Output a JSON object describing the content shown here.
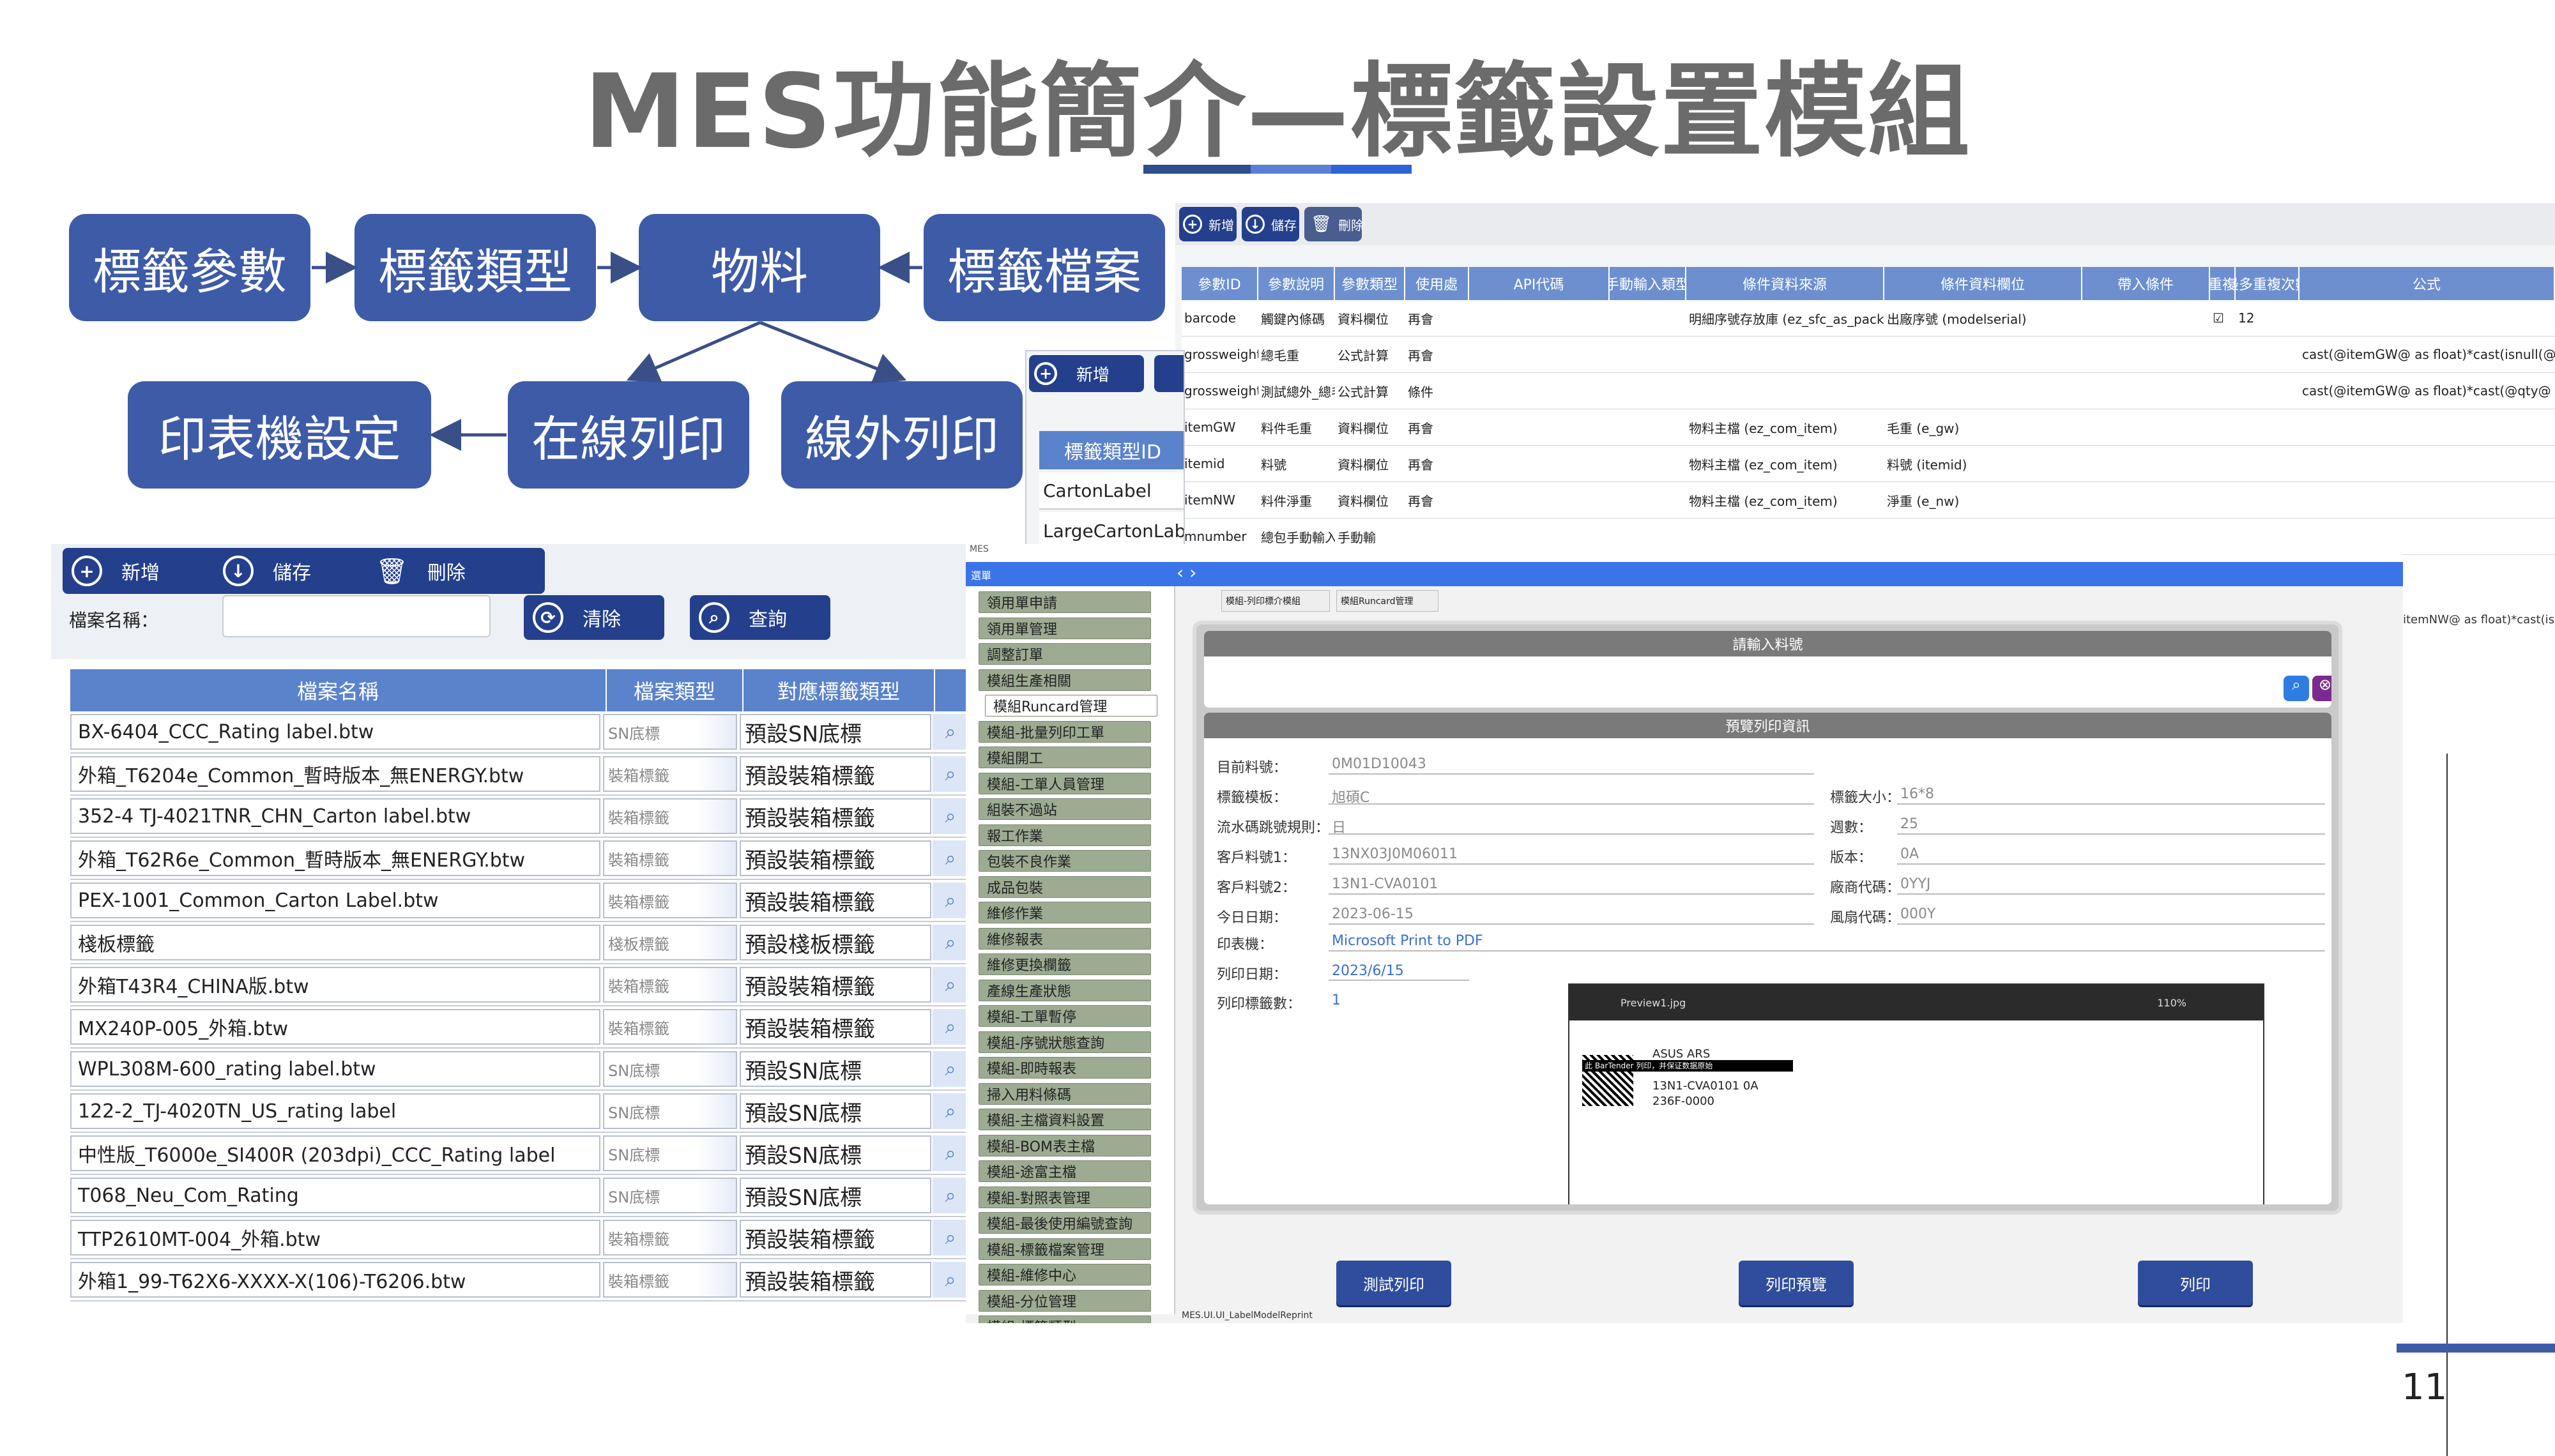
{
  "slide": {
    "title": "MES功能簡介—標籤設置模組",
    "page_number": "11"
  },
  "flow": {
    "n1": "標籤參數",
    "n2": "標籤類型",
    "n3": "物料",
    "n4": "標籤檔案",
    "n5": "印表機設定",
    "n6": "在線列印",
    "n7": "線外列印"
  },
  "file_win": {
    "btn_add": "新增",
    "btn_save": "儲存",
    "btn_delete": "刪除",
    "btn_clear": "清除",
    "btn_query": "查詢",
    "search_label": "檔案名稱：",
    "search_value": "",
    "headers": [
      "檔案名稱",
      "檔案類型",
      "對應標籤類型"
    ],
    "rows": [
      [
        "BX-6404_CCC_Rating label.btw",
        "SN底標",
        "預設SN底標"
      ],
      [
        "外箱_T6204e_Common_暫時版本_無ENERGY.btw",
        "裝箱標籤",
        "預設裝箱標籤"
      ],
      [
        "352-4 TJ-4021TNR_CHN_Carton label.btw",
        "裝箱標籤",
        "預設裝箱標籤"
      ],
      [
        "外箱_T62R6e_Common_暫時版本_無ENERGY.btw",
        "裝箱標籤",
        "預設裝箱標籤"
      ],
      [
        "PEX-1001_Common_Carton Label.btw",
        "裝箱標籤",
        "預設裝箱標籤"
      ],
      [
        "棧板標籤",
        "棧板標籤",
        "預設棧板標籤"
      ],
      [
        "外箱T43R4_CHINA版.btw",
        "裝箱標籤",
        "預設裝箱標籤"
      ],
      [
        "MX240P-005_外箱.btw",
        "裝箱標籤",
        "預設裝箱標籤"
      ],
      [
        "WPL308M-600_rating label.btw",
        "SN底標",
        "預設SN底標"
      ],
      [
        "122-2_TJ-4020TN_US_rating label",
        "SN底標",
        "預設SN底標"
      ],
      [
        "中性版_T6000e_SI400R (203dpi)_CCC_Rating label",
        "SN底標",
        "預設SN底標"
      ],
      [
        "T068_Neu_Com_Rating",
        "SN底標",
        "預設SN底標"
      ],
      [
        "TTP2610MT-004_外箱.btw",
        "裝箱標籤",
        "預設裝箱標籤"
      ],
      [
        "外箱1_99-T62X6-XXXX-X(106)-T6206.btw",
        "裝箱標籤",
        "預設裝箱標籤"
      ]
    ]
  },
  "type_win": {
    "btn_add": "新增",
    "header": "標籤類型ID",
    "rows": [
      "CartonLabel",
      "LargeCartonLabel"
    ]
  },
  "param_win": {
    "btn_add": "新增",
    "btn_save": "儲存",
    "btn_delete": "刪除",
    "headers": [
      "參數ID",
      "參數說明",
      "參數類型",
      "使用處",
      "API代碼",
      "手動輸入類型",
      "條件資料來源",
      "條件資料欄位",
      "帶入條件",
      "重複",
      "最多重複次數",
      "公式"
    ],
    "rows": [
      [
        "barcode",
        "觸鍵內條碼",
        "資料欄位",
        "再會",
        "",
        "",
        "明細序號存放庫 (ez_sfc_as_package_distle)",
        "出廠序號 (modelserial)",
        "",
        "☑",
        "12",
        ""
      ],
      [
        "grossweight",
        "總毛重",
        "公式計算",
        "再會",
        "",
        "",
        "",
        "",
        "",
        "",
        "",
        "cast(@itemGW@ as float)*cast(isnull(@"
      ],
      [
        "grossweight_TEST",
        "測試總外_總毛重",
        "公式計算",
        "條件",
        "",
        "",
        "",
        "",
        "",
        "",
        "",
        "cast(@itemGW@ as float)*cast(@qty@ a"
      ],
      [
        "itemGW",
        "料件毛重",
        "資料欄位",
        "再會",
        "",
        "",
        "物料主檔 (ez_com_item)",
        "毛重 (e_gw)",
        "",
        "",
        "",
        ""
      ],
      [
        "itemid",
        "料號",
        "資料欄位",
        "再會",
        "",
        "",
        "物料主檔 (ez_com_item)",
        "料號 (itemid)",
        "",
        "",
        "",
        ""
      ],
      [
        "itemNW",
        "料件淨重",
        "資料欄位",
        "再會",
        "",
        "",
        "物料主檔 (ez_com_item)",
        "淨重 (e_nw)",
        "",
        "",
        "",
        ""
      ],
      [
        "mnumber",
        "總包手動輸入測試",
        "手動輸",
        "",
        "",
        "",
        "",
        "",
        "",
        "",
        "",
        ""
      ]
    ],
    "extra_formula": "itemNW@ as float)*cast(isnull(@"
  },
  "mes_win": {
    "app_title": "MES",
    "menu_label": "選單",
    "status_bar": "MES.UI.UI_LabelModelReprint",
    "tabs": [
      "模組-列印標介模組",
      "模組Runcard管理"
    ],
    "menu": [
      "領用單申請",
      "領用單管理",
      "調整訂單",
      "模組生產相關",
      "模組Runcard管理",
      "模組-批量列印工單",
      "模組開工",
      "模組-工單人員管理",
      "組裝不過站",
      "報工作業",
      "包裝不良作業",
      "成品包裝",
      "維修作業",
      "維修報表",
      "維修更換欄籤",
      "產線生產狀態",
      "模組-工單暫停",
      "模組-序號狀態查詢",
      "模組-即時報表",
      "掃入用料條碼",
      "模組-主檔資料設置",
      "模組-BOM表主檔",
      "模組-途富主檔",
      "模組-對照表管理",
      "模組-最後使用編號查詢",
      "模組-標籤檔案管理",
      "模組-維修中心",
      "模組-分位管理",
      "模組-標籤類型"
    ],
    "input_section": "請輸入料號",
    "preview_section": "預覽列印資訊",
    "fields_left": [
      [
        "目前料號：",
        "0M01D10043"
      ],
      [
        "標籤模板：",
        "旭碩C"
      ],
      [
        "流水碼跳號規則：",
        "日"
      ],
      [
        "客戶料號1：",
        "13NX03J0M06011"
      ],
      [
        "客戶料號2：",
        "13N1-CVA0101"
      ],
      [
        "今日日期：",
        "2023-06-15"
      ]
    ],
    "fields_right": [
      [
        "標籤大小：",
        "16*8"
      ],
      [
        "週數：",
        "25"
      ],
      [
        "版本：",
        "0A"
      ],
      [
        "廠商代碼：",
        "0YYJ"
      ],
      [
        "風扇代碼：",
        "000Y"
      ]
    ],
    "printer_label": "印表機：",
    "printer_value": "Microsoft Print to PDF",
    "date_label": "列印日期：",
    "date_value": "2023/6/15",
    "count_label": "列印標籤數：",
    "count_value": "1",
    "preview": {
      "filename": "Preview1.jpg",
      "zoom": "110%",
      "l1": "ASUS   ARS",
      "l2": "13N1-CVA0101 0A",
      "l3": "236F-0000",
      "bar": "此 BarTender 列印，并保证数据原始"
    },
    "btn_test": "測試列印",
    "btn_preview": "列印預覽",
    "btn_print": "列印"
  }
}
